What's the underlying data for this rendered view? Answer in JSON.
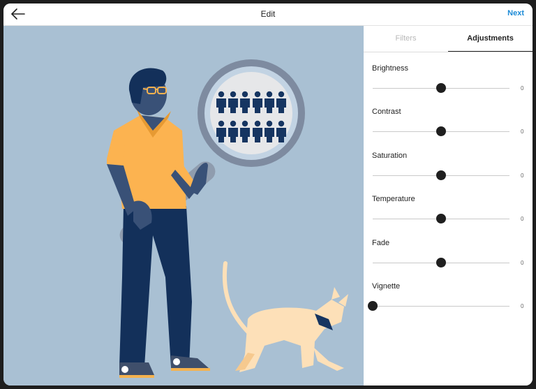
{
  "header": {
    "title": "Edit",
    "next_label": "Next",
    "accent_color": "#1b8ad6",
    "back_icon": "arrow-left-icon"
  },
  "tabs": [
    {
      "label": "Filters",
      "active": false
    },
    {
      "label": "Adjustments",
      "active": true
    }
  ],
  "adjustments": [
    {
      "label": "Brightness",
      "value": "0",
      "position": 0.5
    },
    {
      "label": "Contrast",
      "value": "0",
      "position": 0.5
    },
    {
      "label": "Saturation",
      "value": "0",
      "position": 0.5
    },
    {
      "label": "Temperature",
      "value": "0",
      "position": 0.5
    },
    {
      "label": "Fade",
      "value": "0",
      "position": 0.5
    },
    {
      "label": "Vignette",
      "value": "0",
      "position": 0.0
    }
  ],
  "image": {
    "background_color": "#a9c0d3",
    "subject": "person-with-magnifier-and-cat-illustration"
  }
}
